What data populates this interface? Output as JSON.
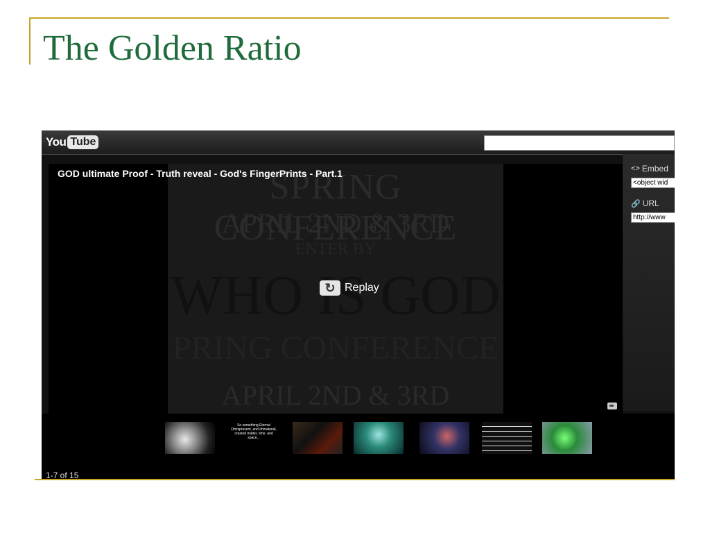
{
  "slide": {
    "title": "The Golden Ratio"
  },
  "player": {
    "logo_you": "You",
    "logo_tube": "Tube",
    "search_value": "",
    "video_title": "GOD ultimate Proof - Truth reveal - God's FingerPrints - Part.1",
    "replay_label": "Replay",
    "poster_lines": [
      "SPRING CONFERENCE",
      "APRIL 2ND & 3RD",
      "ENTER BY",
      "WHO IS GOD",
      "PRING CONFERENCE",
      "APRIL 2ND & 3RD"
    ]
  },
  "side_panel": {
    "embed_label": "Embed",
    "embed_value": "<object wid",
    "url_label": "URL",
    "url_value": "http://www"
  },
  "related": {
    "counter": "1-7 of 15",
    "thumb2_text": "So something Eternal Omnipresent, and Immaterial, created matter, time, and space...",
    "thumbs": [
      {
        "name": "nautilus-shell"
      },
      {
        "name": "text-card"
      },
      {
        "name": "golden-spiral-diagram"
      },
      {
        "name": "green-glow"
      },
      {
        "name": "nebula"
      },
      {
        "name": "spreadsheet-data"
      },
      {
        "name": "green-eye"
      }
    ]
  },
  "colors": {
    "accent_gold": "#c9a227",
    "title_green": "#1f6b3c",
    "player_bg": "#111111"
  }
}
